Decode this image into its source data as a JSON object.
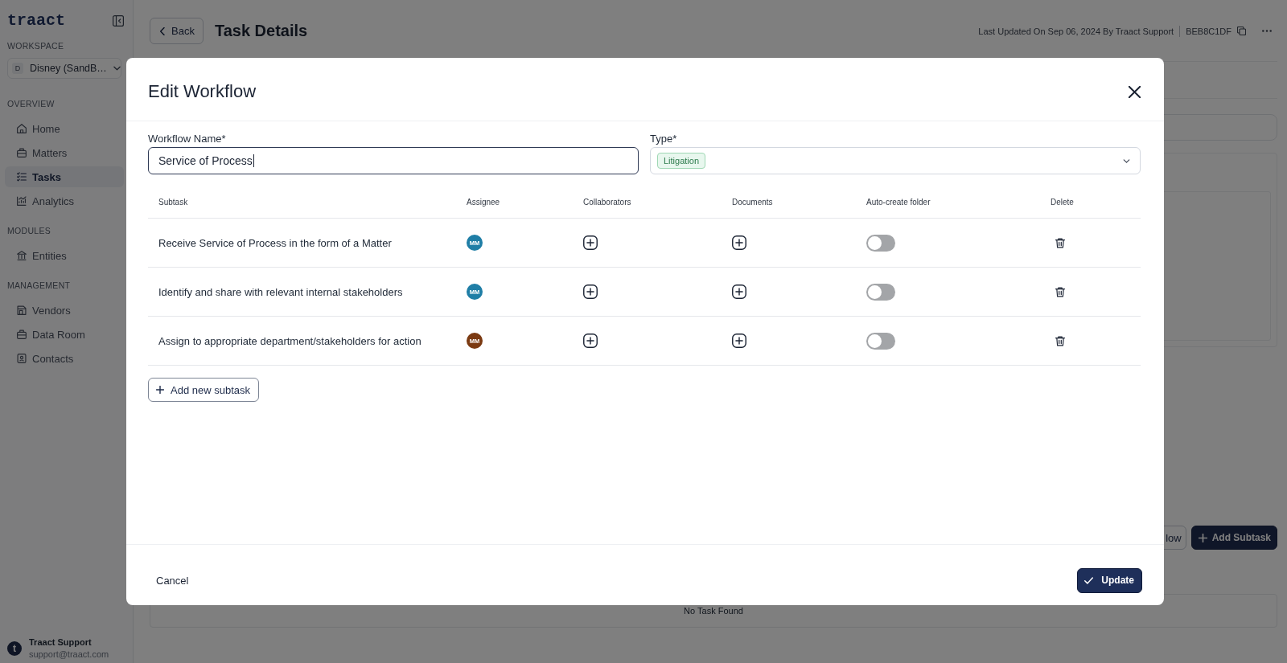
{
  "sidebar": {
    "logo": "traact",
    "workspace_label": "WORKSPACE",
    "workspace": {
      "initial": "D",
      "name": "Disney (SandB…"
    },
    "sections": [
      {
        "title": "OVERVIEW",
        "items": [
          {
            "label": "Home",
            "selected": false
          },
          {
            "label": "Matters",
            "selected": false
          },
          {
            "label": "Tasks",
            "selected": true
          },
          {
            "label": "Analytics",
            "selected": false
          }
        ]
      },
      {
        "title": "MODULES",
        "items": [
          {
            "label": "Entities",
            "selected": false
          }
        ]
      },
      {
        "title": "MANAGEMENT",
        "items": [
          {
            "label": "Vendors",
            "selected": false
          },
          {
            "label": "Data Room",
            "selected": false
          },
          {
            "label": "Contacts",
            "selected": false
          }
        ]
      }
    ],
    "user": {
      "initial": "t",
      "name": "Traact Support",
      "email": "support@traact.com"
    }
  },
  "header": {
    "back_label": "Back",
    "title": "Task Details",
    "last_updated": "Last Updated On Sep 06, 2024 By Traact Support",
    "task_id": "BEB8C1DF"
  },
  "page_actions": [
    {
      "label": "low",
      "kind": "outline"
    },
    {
      "label": "Add Subtask",
      "kind": "primary"
    }
  ],
  "empty_state": "No Task Found",
  "modal": {
    "title": "Edit Workflow",
    "name_field": {
      "label": "Workflow Name*",
      "value": "Service of Process",
      "focused": true
    },
    "type_field": {
      "label": "Type*",
      "tags": [
        "Litigation"
      ]
    },
    "table": {
      "columns": [
        "Subtask",
        "Assignee",
        "Collaborators",
        "Documents",
        "Auto-create folder",
        "Delete"
      ],
      "rows": [
        {
          "subtask": "Receive Service of Process in the form of a Matter",
          "assignee": {
            "initials": "MM",
            "color": "#1f7ea6"
          },
          "auto_create_folder": false
        },
        {
          "subtask": "Identify and share with relevant internal stakeholders",
          "assignee": {
            "initials": "MM",
            "color": "#1f7ea6"
          },
          "auto_create_folder": false
        },
        {
          "subtask": "Assign to appropriate department/stakeholders for action",
          "assignee": {
            "initials": "MM",
            "color": "#7b3a12"
          },
          "auto_create_folder": false
        }
      ]
    },
    "add_subtask_label": "Add new subtask",
    "cancel_label": "Cancel",
    "submit_label": "Update"
  }
}
